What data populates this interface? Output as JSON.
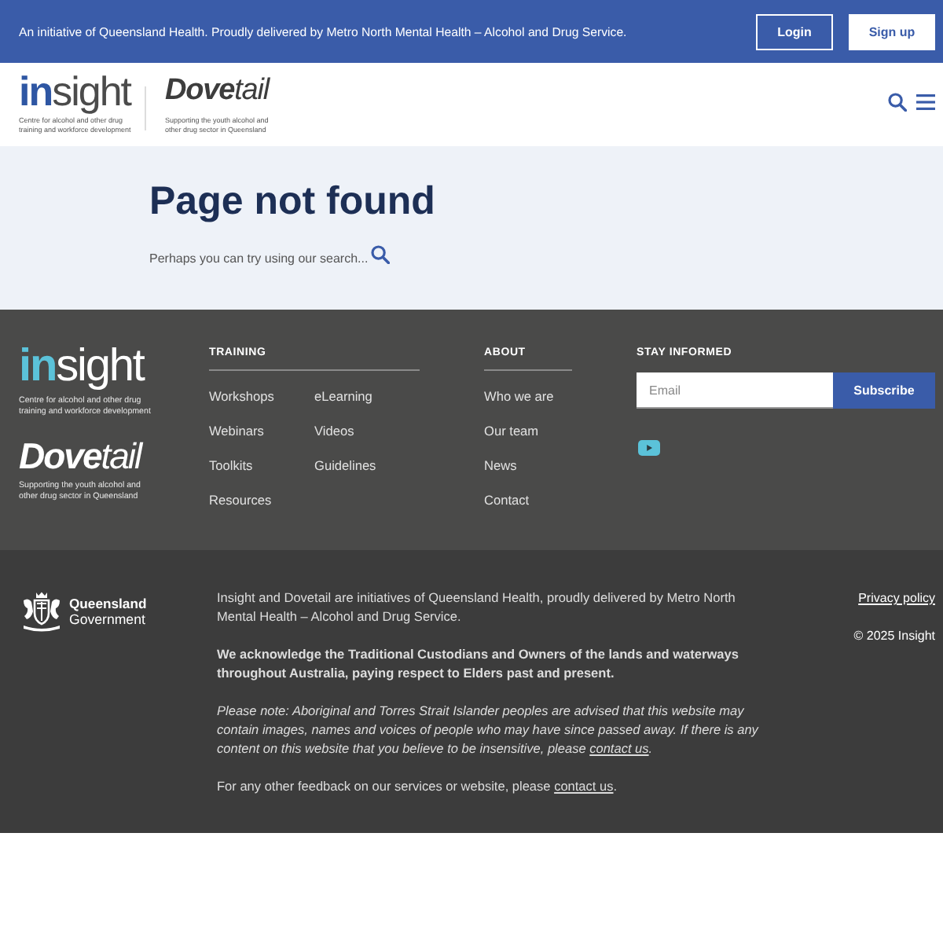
{
  "top_bar": {
    "text": "An initiative of Queensland Health. Proudly delivered by Metro North Mental Health – Alcohol and Drug Service.",
    "buttons": [
      {
        "label": "Login",
        "kind": "outline"
      },
      {
        "label": "Sign up",
        "kind": "solid"
      }
    ]
  },
  "header": {
    "logos": [
      {
        "kind": "roman",
        "wordmark": "**in**sight",
        "tagline": "Centre for alcohol and other drug training and workforce development"
      },
      {
        "kind": "italic",
        "wordmark": "**Dove**tail",
        "tagline": "Supporting the youth alcohol and other drug sector in Queensland"
      }
    ]
  },
  "hero": {
    "title": "Page not found",
    "text": "Perhaps you can try using our search..."
  },
  "footer": {
    "logos": [
      {
        "kind": "roman",
        "wordmark": "**in**sight",
        "tagline": "Centre for alcohol and other drug training and workforce development"
      },
      {
        "kind": "italic",
        "wordmark": "**Dove**tail",
        "tagline": "Supporting the youth alcohol and other drug sector in Queensland"
      }
    ],
    "columns": [
      {
        "heading": "TRAINING",
        "links": [
          "Workshops",
          "eLearning",
          "Webinars",
          "Videos",
          "Toolkits",
          "Guidelines",
          "Resources"
        ]
      },
      {
        "heading": "ABOUT",
        "links": [
          "Who we are",
          "Our team",
          "News",
          "Contact"
        ]
      }
    ],
    "newsletter": {
      "heading": "STAY INFORMED",
      "placeholder": "Email",
      "button": "Subscribe"
    }
  },
  "legal": {
    "government": {
      "title": "Queensland",
      "subtitle": "Government"
    },
    "paragraphs": [
      {
        "kind": "plain",
        "text": "Insight and Dovetail are initiatives of Queensland Health, proudly delivered by Metro North Mental Health – Alcohol and Drug Service."
      },
      {
        "kind": "bold",
        "text": "We acknowledge the Traditional Custodians and Owners of the lands and waterways throughout Australia, paying respect to Elders past and present."
      },
      {
        "kind": "italic",
        "text": "Please note: Aboriginal and Torres Strait Islander peoples are advised that this website may contain images, names and voices of people who may have since passed away. If there is any content on this website that you believe to be insensitive, please",
        "link": "contact us",
        "after": "."
      },
      {
        "kind": "plain",
        "text": "For any other feedback on our services or website, please",
        "link": "contact us",
        "after": "."
      }
    ],
    "privacy_link": "Privacy policy",
    "copyright": "© 2025 Insight"
  }
}
